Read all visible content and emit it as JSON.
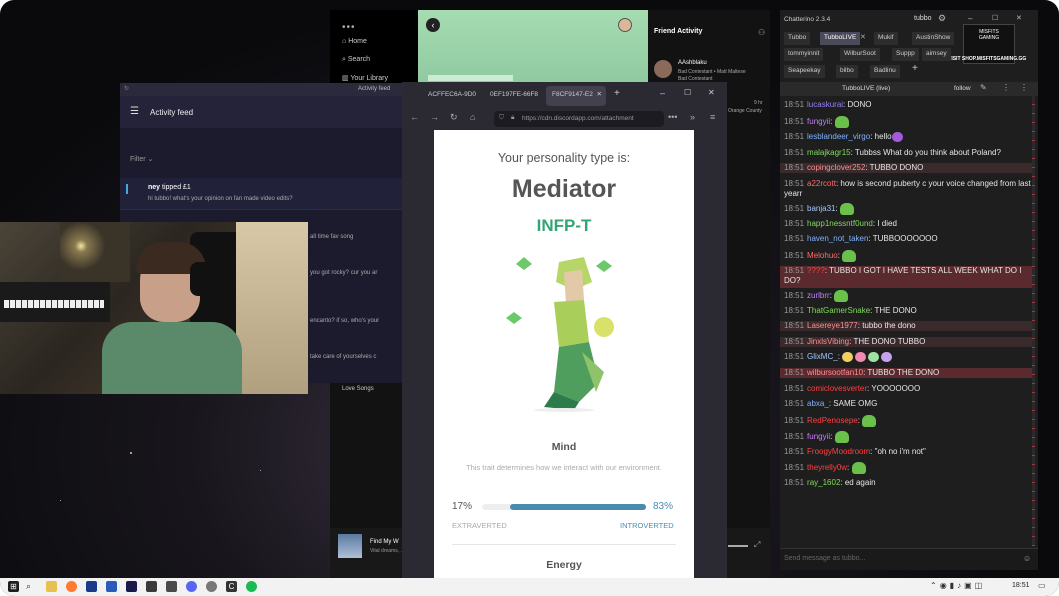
{
  "spotify": {
    "nav": [
      "Home",
      "Search",
      "Your Library"
    ],
    "friend_activity_title": "Friend Activity",
    "friend": {
      "name": "AAshblaku",
      "line1": "Bad Contestant • Matt Maltese",
      "line2": "Bad Contestant"
    },
    "side_snippet": [
      "9 hr",
      "Angel",
      "Orange County"
    ],
    "now_playing": {
      "title": "Find My W",
      "sub": "Vital dreams, ..."
    },
    "playlist": "Love Songs"
  },
  "activity_feed": {
    "window_title": "Activity feed",
    "title": "Activity feed",
    "filter_label": "Filter",
    "tip": {
      "user": "ney",
      "action": "tipped £1",
      "message": "hi tubbo! what's your opinion on fan made video edits?"
    },
    "snippets": [
      "all time fav song",
      "you got rocky? cur you ar",
      "encanto? if so, who's your",
      "take care of yourselves c"
    ]
  },
  "firefox": {
    "tabs": [
      {
        "label": "ACFFEC6A-9D0"
      },
      {
        "label": "0EF197FE-66F8"
      },
      {
        "label": "F8CF9147-E2"
      }
    ],
    "url": "https://cdn.discordapp.com/attachment",
    "page": {
      "heading": "Your personality type is:",
      "type_name": "Mediator",
      "type_code": "INFP-T",
      "trait_title": "Mind",
      "trait_desc": "This trait determines how we interact with our environment.",
      "left_pct": "17%",
      "right_pct": "83%",
      "left_label": "EXTRAVERTED",
      "right_label": "INTROVERTED",
      "introverted_fraction": 0.83,
      "next_trait": "Energy"
    },
    "colors": {
      "accent": "#33a474",
      "bar": "#4a8bad"
    }
  },
  "chatterino": {
    "title": "Chatterino 2.3.4",
    "account": "tubbo",
    "tabs_row1": [
      "Tubbo",
      "TubboLIVE",
      "Mukif",
      "AustinShow"
    ],
    "tabs_row2": [
      "tommyinnit",
      "WilburSoot",
      "Suppp",
      "aimsey"
    ],
    "tabs_row3": [
      "Seapeekay",
      "bilbo",
      "Badlinu"
    ],
    "channel": "TubboLIVE (live)",
    "follow": "follow",
    "sponsor": "VISIT SHOP.MISFITSGAMING.GG",
    "input_placeholder": "Send message as tubbo...",
    "messages": [
      {
        "time": "18:51",
        "user": "lucaskurai",
        "color": "#9a7dff",
        "text": "DONO",
        "hl": ""
      },
      {
        "time": "18:51",
        "user": "fungyii",
        "color": "#c87dff",
        "text": "",
        "hl": ""
      },
      {
        "time": "18:51",
        "user": "lesblandeer_virgo",
        "color": "#7fb3ff",
        "text": "hello",
        "hl": ""
      },
      {
        "time": "18:51",
        "user": "malajkagr15",
        "color": "#7fdc5a",
        "text": "Tubbss What do you think about Poland?",
        "hl": ""
      },
      {
        "time": "18:51",
        "user": "copingclover252",
        "color": "#ff8f8f",
        "text": "TUBBO DONO",
        "hl": "sel"
      },
      {
        "time": "18:51",
        "user": "a22rcott",
        "color": "#ff6b6b",
        "text": "how is second puberty c your voice changed from last yearr",
        "hl": ""
      },
      {
        "time": "18:51",
        "user": "banja31",
        "color": "#a0c8ff",
        "text": "",
        "hl": ""
      },
      {
        "time": "18:51",
        "user": "happ1nessntf0und",
        "color": "#7fdc5a",
        "text": "I died",
        "hl": ""
      },
      {
        "time": "18:51",
        "user": "haven_not_taken",
        "color": "#7fb3ff",
        "text": "TUBBOOOOOOO",
        "hl": ""
      },
      {
        "time": "18:51",
        "user": "Melohuo",
        "color": "#ff6b6b",
        "text": "",
        "hl": ""
      },
      {
        "time": "18:51",
        "user": "????",
        "color": "#ff4040",
        "text": "TUBBO I GOT I HAVE TESTS ALL WEEK WHAT DO I DO?",
        "hl": "hl"
      },
      {
        "time": "18:51",
        "user": "zurlbrr",
        "color": "#c87dff",
        "text": "",
        "hl": ""
      },
      {
        "time": "18:51",
        "user": "ThatGamerSnake",
        "color": "#7fdc5a",
        "text": "THE DONO",
        "hl": ""
      },
      {
        "time": "18:51",
        "user": "Lasereye1977",
        "color": "#ff8f8f",
        "text": "tubbo the dono",
        "hl": "sel"
      },
      {
        "time": "18:51",
        "user": "JinxlsVibing",
        "color": "#ff8f8f",
        "text": "THE DONO TUBBO",
        "hl": "sel"
      },
      {
        "time": "18:51",
        "user": "GlixMC_",
        "color": "#a0c8ff",
        "text": "",
        "hl": ""
      },
      {
        "time": "18:51",
        "user": "wilbursootfan10",
        "color": "#ff8f8f",
        "text": "TUBBO THE DONO",
        "hl": "hl"
      },
      {
        "time": "18:51",
        "user": "comiclovesverter",
        "color": "#ff4040",
        "text": "YOOOOOOO",
        "hl": ""
      },
      {
        "time": "18:51",
        "user": "abxa_",
        "color": "#7fb3ff",
        "text": "SAME OMG",
        "hl": ""
      },
      {
        "time": "18:51",
        "user": "RedPenosepe",
        "color": "#ff4040",
        "text": "",
        "hl": ""
      },
      {
        "time": "18:51",
        "user": "fungyii",
        "color": "#c87dff",
        "text": "",
        "hl": ""
      },
      {
        "time": "18:51",
        "user": "FroogyMoodroom",
        "color": "#ff4040",
        "text": "\"oh no i'm not\"",
        "hl": ""
      },
      {
        "time": "18:51",
        "user": "theyrelly0w",
        "color": "#ff4040",
        "text": "",
        "hl": ""
      },
      {
        "time": "18:51",
        "user": "ray_1602",
        "color": "#7fdc5a",
        "text": "ed again",
        "hl": ""
      }
    ]
  },
  "taskbar": {
    "time": "18:51"
  },
  "icons": [
    "home-icon",
    "search-icon",
    "library-icon",
    "back-icon",
    "hamburger-icon",
    "filter-chevron-icon",
    "reload-icon",
    "shield-icon",
    "lock-icon",
    "gear-icon",
    "windows-start-icon",
    "chevron-left-icon"
  ]
}
